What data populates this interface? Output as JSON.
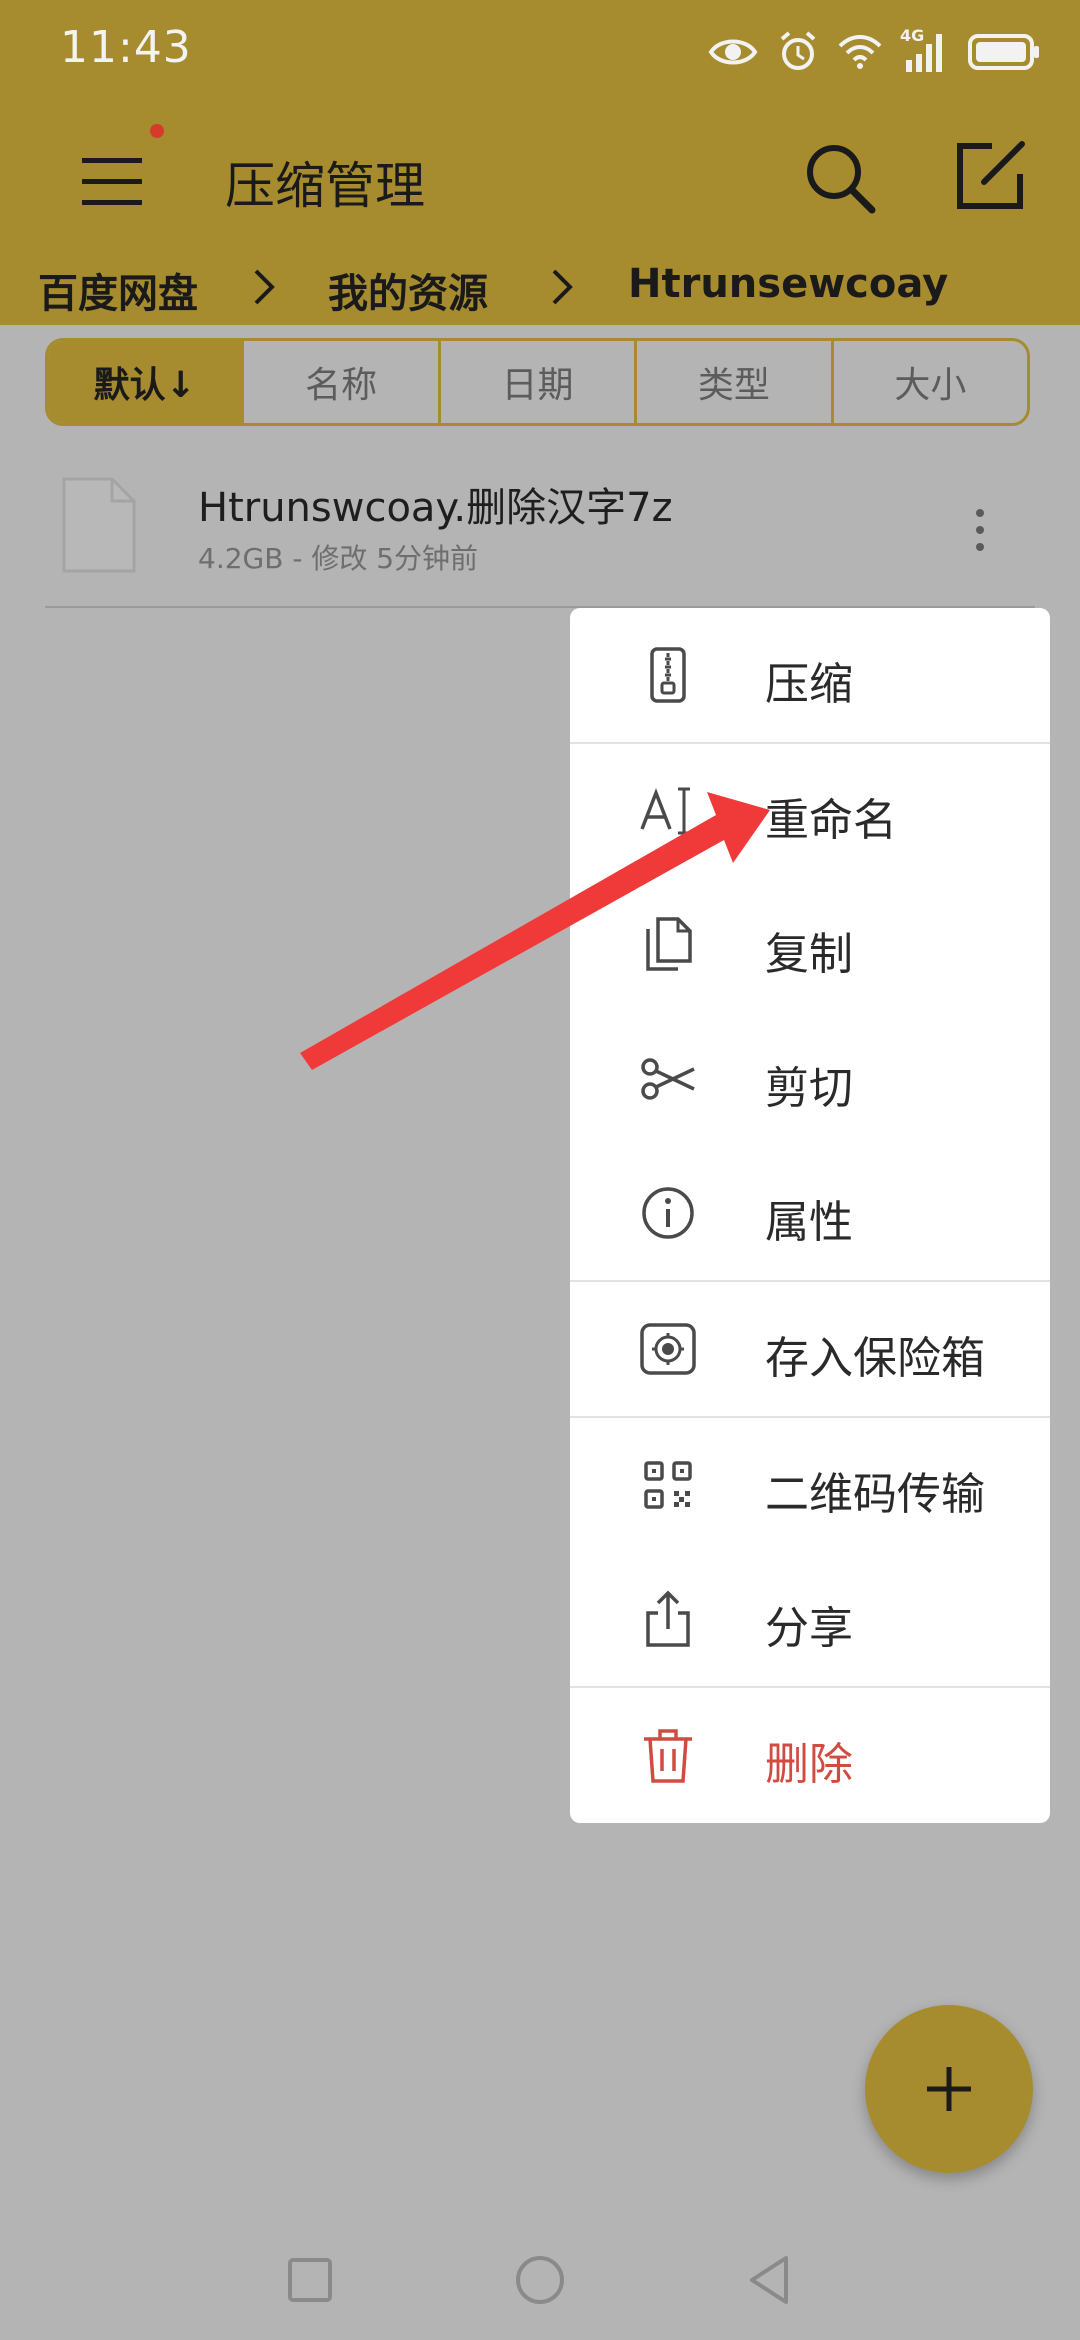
{
  "status_bar": {
    "time": "11:43",
    "network_label": "4G",
    "icons": [
      "eye-icon",
      "alarm-icon",
      "wifi-icon",
      "signal-icon",
      "battery-icon"
    ]
  },
  "toolbar": {
    "title": "压缩管理",
    "icons": [
      "menu-icon",
      "search-icon",
      "edit-icon"
    ]
  },
  "breadcrumb": {
    "items": [
      "百度网盘",
      "我的资源",
      "Htrunsewcoay"
    ]
  },
  "sort_tabs": [
    {
      "label": "默认↓",
      "active": true
    },
    {
      "label": "名称",
      "active": false
    },
    {
      "label": "日期",
      "active": false
    },
    {
      "label": "类型",
      "active": false
    },
    {
      "label": "大小",
      "active": false
    }
  ],
  "file": {
    "name": "Htrunswcoay.删除汉字7z",
    "meta": "4.2GB - 修改 5分钟前"
  },
  "context_menu": {
    "items": [
      {
        "label": "压缩",
        "icon": "zip-icon"
      },
      {
        "label": "重命名",
        "icon": "rename-icon"
      },
      {
        "label": "复制",
        "icon": "copy-icon"
      },
      {
        "label": "剪切",
        "icon": "scissors-icon"
      },
      {
        "label": "属性",
        "icon": "info-icon"
      },
      {
        "label": "存入保险箱",
        "icon": "vault-icon"
      },
      {
        "label": "二维码传输",
        "icon": "qr-code-icon"
      },
      {
        "label": "分享",
        "icon": "share-icon"
      },
      {
        "label": "删除",
        "icon": "trash-icon"
      }
    ]
  },
  "colors": {
    "header": "#a68c2f",
    "dim_background": "#b4b4b4",
    "danger": "#d24b40",
    "arrow": "#f03a3a"
  }
}
